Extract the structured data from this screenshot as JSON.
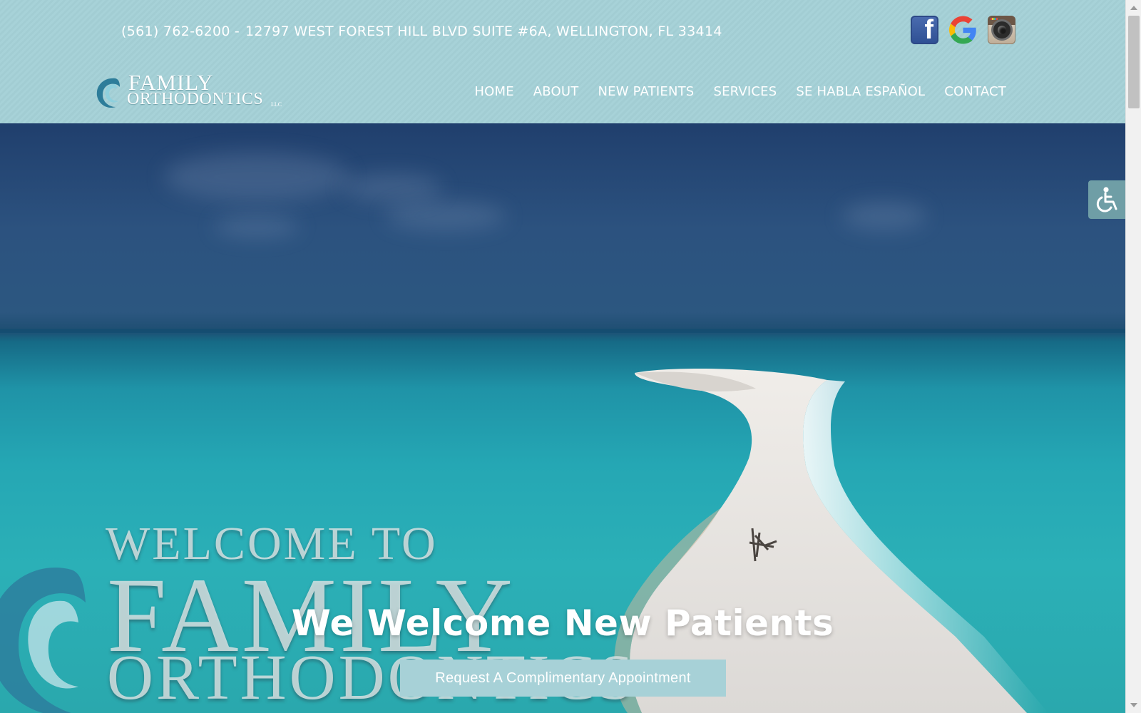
{
  "topbar": {
    "phone": "(561) 762-6200",
    "separator": "-",
    "address": "12797 WEST FOREST HILL BLVD SUITE #6A, WELLINGTON, FL 33414"
  },
  "social": [
    {
      "icon": "facebook-icon",
      "glyph": "f"
    },
    {
      "icon": "google-icon"
    },
    {
      "icon": "instagram-icon"
    }
  ],
  "logo": {
    "line1": "FAMILY",
    "line2": "ORTHODONTICS",
    "suffix": "LLC"
  },
  "nav": {
    "items": [
      "HOME",
      "ABOUT",
      "NEW PATIENTS",
      "SERVICES",
      "SE HABLA ESPAÑOL",
      "CONTACT"
    ]
  },
  "hero": {
    "watermark_line1": "WELCOME TO",
    "watermark_line2": "FAMILY",
    "watermark_line3": "ORTHODONTICS",
    "title": "We Welcome New Patients",
    "cta_label": "Request A Complimentary Appointment"
  },
  "accessibility": {
    "icon": "wheelchair-icon"
  },
  "colors": {
    "header_bg": "#a7d2d8",
    "cta_bg": "#a7d1d7",
    "sky": "#203f6d",
    "water": "#2bb0b7",
    "sand": "#e9e6e2",
    "a11y_bg": "#6f9ea6"
  }
}
